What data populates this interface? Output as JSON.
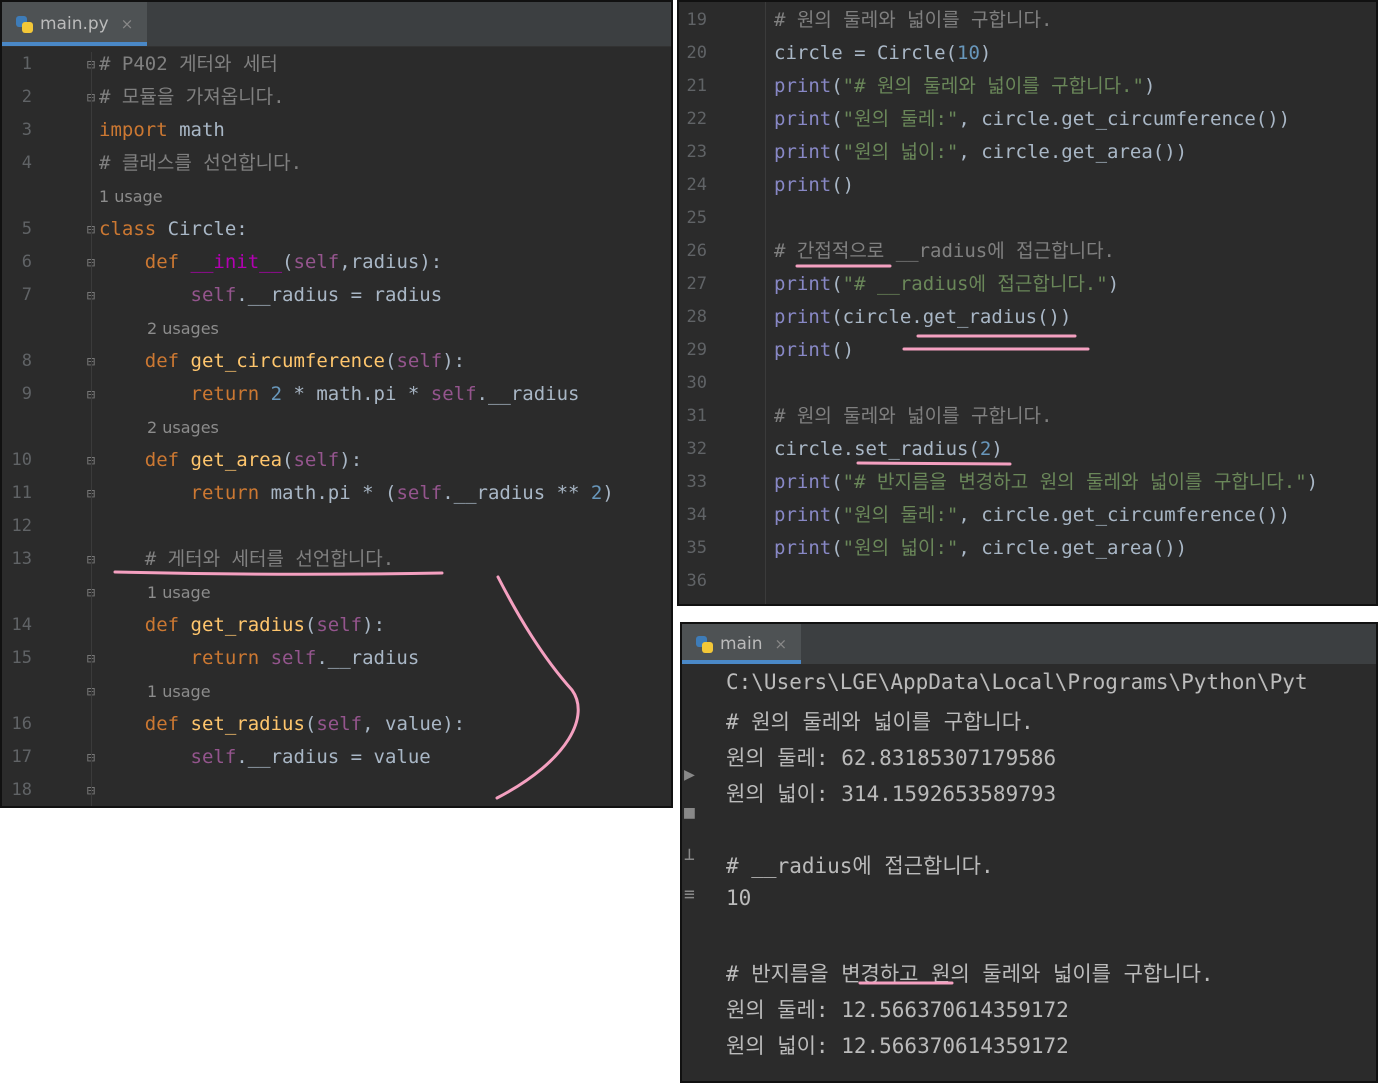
{
  "editor_left": {
    "tab": {
      "label": "main.py",
      "close": "×"
    },
    "lines": [
      {
        "num": "1",
        "parts": [
          {
            "t": "# P402 게터와 세터",
            "c": "cmt"
          }
        ]
      },
      {
        "num": "2",
        "parts": [
          {
            "t": "# 모듈을 가져옵니다.",
            "c": "cmt"
          }
        ]
      },
      {
        "num": "3",
        "parts": [
          {
            "t": "import ",
            "c": "kw"
          },
          {
            "t": "math",
            "c": "plain"
          }
        ]
      },
      {
        "num": "4",
        "parts": [
          {
            "t": "# 클래스를 선언합니다.",
            "c": "cmt"
          }
        ]
      },
      {
        "hint": "1 usage"
      },
      {
        "num": "5",
        "parts": [
          {
            "t": "class ",
            "c": "kw"
          },
          {
            "t": "Circle:",
            "c": "plain"
          }
        ]
      },
      {
        "num": "6",
        "parts": [
          {
            "t": "    def ",
            "c": "kw"
          },
          {
            "t": "__init__",
            "c": "magic"
          },
          {
            "t": "(",
            "c": "plain"
          },
          {
            "t": "self",
            "c": "selfc"
          },
          {
            "t": ",radius):",
            "c": "plain"
          }
        ]
      },
      {
        "num": "7",
        "parts": [
          {
            "t": "        self",
            "c": "selfc"
          },
          {
            "t": ".__radius = radius",
            "c": "plain"
          }
        ]
      },
      {
        "hint": "2 usages"
      },
      {
        "num": "8",
        "parts": [
          {
            "t": "    def ",
            "c": "kw"
          },
          {
            "t": "get_circumference",
            "c": "fn"
          },
          {
            "t": "(",
            "c": "plain"
          },
          {
            "t": "self",
            "c": "selfc"
          },
          {
            "t": "):",
            "c": "plain"
          }
        ]
      },
      {
        "num": "9",
        "parts": [
          {
            "t": "        return ",
            "c": "kw"
          },
          {
            "t": "2",
            "c": "num"
          },
          {
            "t": " * math.pi * ",
            "c": "plain"
          },
          {
            "t": "self",
            "c": "selfc"
          },
          {
            "t": ".__radius",
            "c": "plain"
          }
        ]
      },
      {
        "hint": "2 usages"
      },
      {
        "num": "10",
        "parts": [
          {
            "t": "    def ",
            "c": "kw"
          },
          {
            "t": "get_area",
            "c": "fn"
          },
          {
            "t": "(",
            "c": "plain"
          },
          {
            "t": "self",
            "c": "selfc"
          },
          {
            "t": "):",
            "c": "plain"
          }
        ]
      },
      {
        "num": "11",
        "parts": [
          {
            "t": "        return ",
            "c": "kw"
          },
          {
            "t": "math.pi * (",
            "c": "plain"
          },
          {
            "t": "self",
            "c": "selfc"
          },
          {
            "t": ".__radius ** ",
            "c": "plain"
          },
          {
            "t": "2",
            "c": "num"
          },
          {
            "t": ")",
            "c": "plain"
          }
        ]
      },
      {
        "num": "12",
        "parts": []
      },
      {
        "num": "13",
        "parts": [
          {
            "t": "    # 게터와 세터를 선언합니다.",
            "c": "cmt"
          }
        ]
      },
      {
        "hint": "1 usage"
      },
      {
        "num": "14",
        "parts": [
          {
            "t": "    def ",
            "c": "kw"
          },
          {
            "t": "get_radius",
            "c": "fn"
          },
          {
            "t": "(",
            "c": "plain"
          },
          {
            "t": "self",
            "c": "selfc"
          },
          {
            "t": "):",
            "c": "plain"
          }
        ]
      },
      {
        "num": "15",
        "parts": [
          {
            "t": "        return ",
            "c": "kw"
          },
          {
            "t": "self",
            "c": "selfc"
          },
          {
            "t": ".__radius",
            "c": "plain"
          }
        ]
      },
      {
        "hint": "1 usage"
      },
      {
        "num": "16",
        "parts": [
          {
            "t": "    def ",
            "c": "kw"
          },
          {
            "t": "set_radius",
            "c": "fn"
          },
          {
            "t": "(",
            "c": "plain"
          },
          {
            "t": "self",
            "c": "selfc"
          },
          {
            "t": ", value):",
            "c": "plain"
          }
        ]
      },
      {
        "num": "17",
        "parts": [
          {
            "t": "        self",
            "c": "selfc"
          },
          {
            "t": ".__radius = value",
            "c": "plain"
          }
        ]
      },
      {
        "num": "18",
        "parts": []
      }
    ]
  },
  "editor_right": {
    "lines": [
      {
        "num": "19",
        "parts": [
          {
            "t": "# 원의 둘레와 넓이를 구합니다.",
            "c": "cmt"
          }
        ]
      },
      {
        "num": "20",
        "parts": [
          {
            "t": "circle = Circle(",
            "c": "plain"
          },
          {
            "t": "10",
            "c": "num"
          },
          {
            "t": ")",
            "c": "plain"
          }
        ]
      },
      {
        "num": "21",
        "parts": [
          {
            "t": "print",
            "c": "builtin"
          },
          {
            "t": "(",
            "c": "plain"
          },
          {
            "t": "\"# 원의 둘레와 넓이를 구합니다.\"",
            "c": "str"
          },
          {
            "t": ")",
            "c": "plain"
          }
        ]
      },
      {
        "num": "22",
        "parts": [
          {
            "t": "print",
            "c": "builtin"
          },
          {
            "t": "(",
            "c": "plain"
          },
          {
            "t": "\"원의 둘레:\"",
            "c": "str"
          },
          {
            "t": ", circle.get_circumference())",
            "c": "plain"
          }
        ]
      },
      {
        "num": "23",
        "parts": [
          {
            "t": "print",
            "c": "builtin"
          },
          {
            "t": "(",
            "c": "plain"
          },
          {
            "t": "\"원의 넓이:\"",
            "c": "str"
          },
          {
            "t": ", circle.get_area())",
            "c": "plain"
          }
        ]
      },
      {
        "num": "24",
        "parts": [
          {
            "t": "print",
            "c": "builtin"
          },
          {
            "t": "()",
            "c": "plain"
          }
        ]
      },
      {
        "num": "25",
        "parts": []
      },
      {
        "num": "26",
        "parts": [
          {
            "t": "# 간접적으로 __radius에 접근합니다.",
            "c": "cmt"
          }
        ]
      },
      {
        "num": "27",
        "parts": [
          {
            "t": "print",
            "c": "builtin"
          },
          {
            "t": "(",
            "c": "plain"
          },
          {
            "t": "\"# __radius에 접근합니다.\"",
            "c": "str"
          },
          {
            "t": ")",
            "c": "plain"
          }
        ]
      },
      {
        "num": "28",
        "parts": [
          {
            "t": "print",
            "c": "builtin"
          },
          {
            "t": "(circle.get_radius())",
            "c": "plain"
          }
        ]
      },
      {
        "num": "29",
        "parts": [
          {
            "t": "print",
            "c": "builtin"
          },
          {
            "t": "()",
            "c": "plain"
          }
        ]
      },
      {
        "num": "30",
        "parts": []
      },
      {
        "num": "31",
        "parts": [
          {
            "t": "# 원의 둘레와 넓이를 구합니다.",
            "c": "cmt"
          }
        ]
      },
      {
        "num": "32",
        "parts": [
          {
            "t": "circle.set_radius(",
            "c": "plain"
          },
          {
            "t": "2",
            "c": "num"
          },
          {
            "t": ")",
            "c": "plain"
          }
        ]
      },
      {
        "num": "33",
        "parts": [
          {
            "t": "print",
            "c": "builtin"
          },
          {
            "t": "(",
            "c": "plain"
          },
          {
            "t": "\"# 반지름을 변경하고 원의 둘레와 넓이를 구합니다.\"",
            "c": "str"
          },
          {
            "t": ")",
            "c": "plain"
          }
        ]
      },
      {
        "num": "34",
        "parts": [
          {
            "t": "print",
            "c": "builtin"
          },
          {
            "t": "(",
            "c": "plain"
          },
          {
            "t": "\"원의 둘레:\"",
            "c": "str"
          },
          {
            "t": ", circle.get_circumference())",
            "c": "plain"
          }
        ]
      },
      {
        "num": "35",
        "parts": [
          {
            "t": "print",
            "c": "builtin"
          },
          {
            "t": "(",
            "c": "plain"
          },
          {
            "t": "\"원의 넓이:\"",
            "c": "str"
          },
          {
            "t": ", circle.get_area())",
            "c": "plain"
          }
        ]
      },
      {
        "num": "36",
        "parts": []
      }
    ]
  },
  "run": {
    "tab": {
      "label": "main",
      "close": "×"
    },
    "output": [
      "C:\\Users\\LGE\\AppData\\Local\\Programs\\Python\\Pyt",
      "# 원의 둘레와 넓이를 구합니다.",
      "원의 둘레: 62.83185307179586",
      "원의 넓이: 314.1592653589793",
      "",
      "# __radius에 접근합니다.",
      "10",
      "",
      "# 반지름을 변경하고 원의 둘레와 넓이를 구합니다.",
      "원의 둘레: 12.566370614359172",
      "원의 넓이: 12.566370614359172"
    ]
  }
}
